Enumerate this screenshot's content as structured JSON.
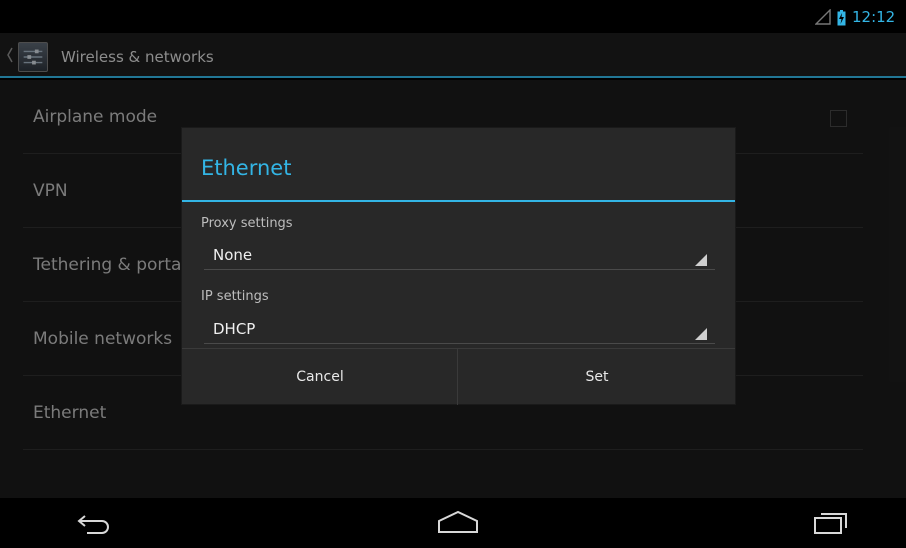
{
  "status_bar": {
    "time": "12:12",
    "icons": [
      "signal-icon",
      "battery-charging-icon"
    ],
    "accent": "#33b5e5"
  },
  "action_bar": {
    "title": "Wireless & networks",
    "icon": "settings-app-icon"
  },
  "settings": {
    "items": [
      {
        "label": "Airplane mode",
        "has_checkbox": true,
        "checked": false
      },
      {
        "label": "VPN"
      },
      {
        "label": "Tethering & porta"
      },
      {
        "label": "Mobile networks"
      },
      {
        "label": "Ethernet"
      }
    ]
  },
  "dialog": {
    "title": "Ethernet",
    "proxy_label": "Proxy settings",
    "proxy_value": "None",
    "ip_label": "IP settings",
    "ip_value": "DHCP",
    "cancel_label": "Cancel",
    "set_label": "Set"
  },
  "nav_bar": {
    "icons": [
      "back-icon",
      "home-icon",
      "recents-icon"
    ]
  }
}
